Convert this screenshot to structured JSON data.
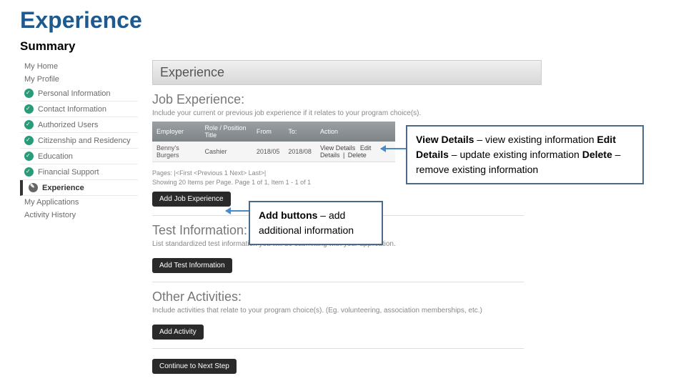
{
  "slide": {
    "title": "Experience",
    "subtitle": "Summary"
  },
  "sidebar": {
    "home": "My Home",
    "profile": "My Profile",
    "items": [
      "Personal Information",
      "Contact Information",
      "Authorized Users",
      "Citizenship and Residency",
      "Education",
      "Financial Support"
    ],
    "active": "Experience",
    "apps": "My Applications",
    "activity": "Activity History"
  },
  "main": {
    "title": "Experience",
    "job": {
      "heading": "Job Experience:",
      "desc": "Include your current or previous job experience if it relates to your program choice(s).",
      "headers": {
        "employer": "Employer",
        "role": "Role / Position Title",
        "from": "From",
        "to": "To:",
        "action": "Action"
      },
      "row": {
        "employer": "Benny's Burgers",
        "role": "Cashier",
        "from": "2018/05",
        "to": "2018/08",
        "view": "View Details",
        "edit": "Edit Details",
        "del": "Delete"
      },
      "paging": "Pages: |<First  <Previous  1 Next>  Last>|",
      "paging2": "Showing 20 Items per Page. Page 1 of 1, Item 1 - 1 of 1",
      "add_btn": "Add Job Experience"
    },
    "test": {
      "heading": "Test Information:",
      "desc": "List standardized test information you will be submitting with your application.",
      "add_btn": "Add Test Information"
    },
    "other": {
      "heading": "Other Activities:",
      "desc": "Include activities that relate to your program choice(s). (Eg. volunteering, association memberships, etc.)",
      "add_btn": "Add Activity"
    },
    "continue_btn": "Continue to Next Step"
  },
  "callouts": {
    "c1": {
      "b1": "View Details",
      "t1": " – view existing information  ",
      "b2": "Edit Details",
      "t2": " – update existing information  ",
      "b3": "Delete",
      "t3": " – remove existing information"
    },
    "c2": {
      "b": "Add buttons",
      "t": " – add additional information"
    }
  }
}
